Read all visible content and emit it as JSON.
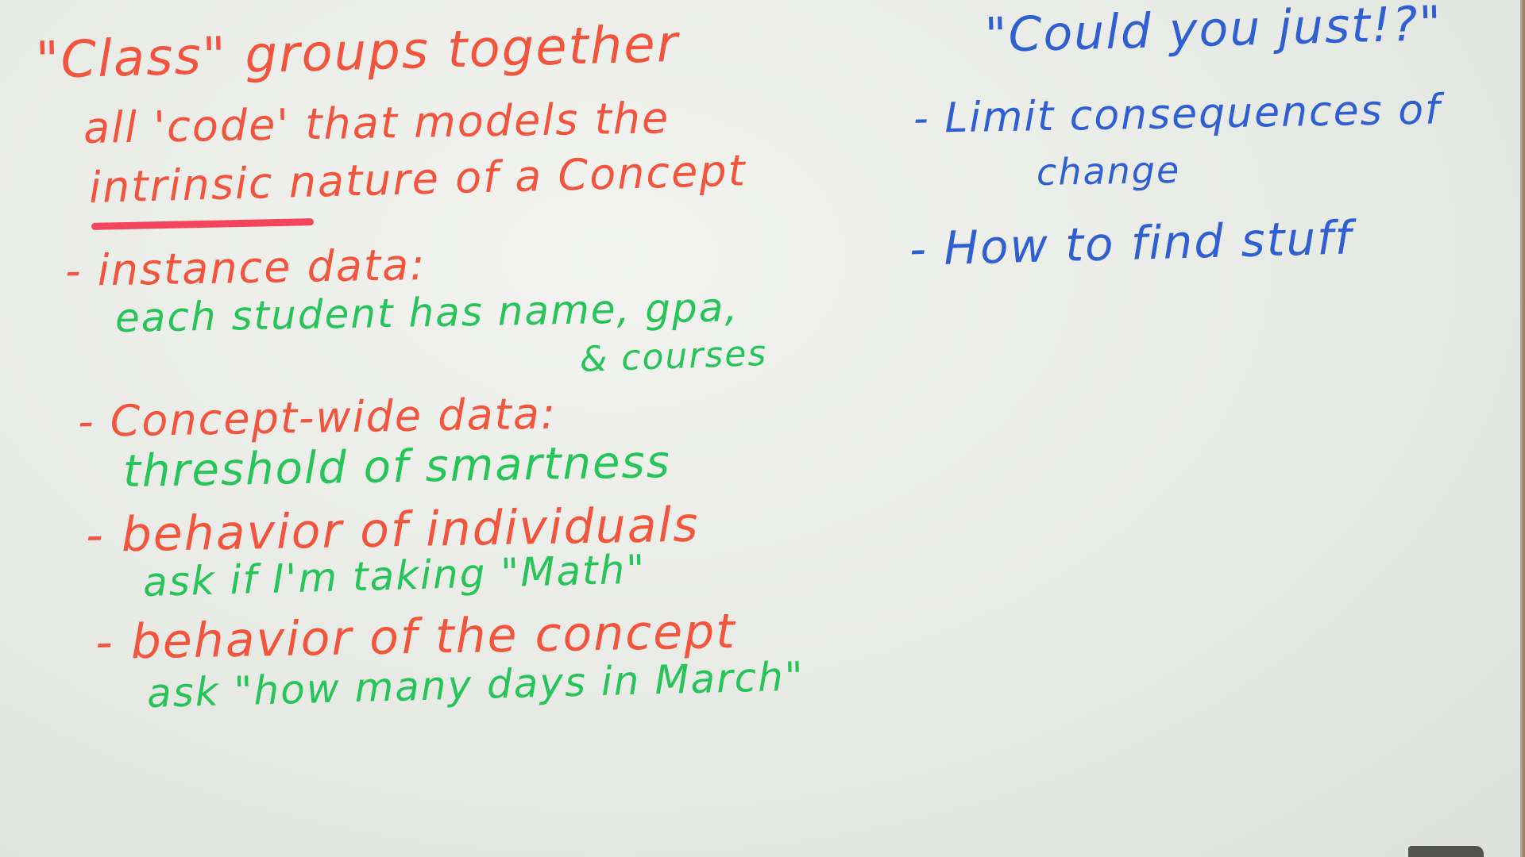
{
  "colors": {
    "red_marker": "#f2553d",
    "green_marker": "#27c45a",
    "blue_marker": "#2f5fd0",
    "board": "#e9ebe6"
  },
  "left_notes": {
    "line1": "\"Class\" groups together",
    "line2": "all 'code' that models the",
    "line3": "intrinsic nature of a Concept",
    "bullet1_title": "- instance data:",
    "bullet1_body_a": "each student has name, gpa,",
    "bullet1_body_b": "& courses",
    "bullet2_title": "- Concept-wide data:",
    "bullet2_body": "threshold of smartness",
    "bullet3_title": "- behavior of individuals",
    "bullet3_body": "ask if I'm taking \"Math\"",
    "bullet4_title": "- behavior of the concept",
    "bullet4_body": "ask \"how many days in March\""
  },
  "right_notes": {
    "title": "\"Could you just!?\"",
    "bullet1_a": "- Limit consequences of",
    "bullet1_b": "change",
    "bullet2": "- How to find stuff"
  }
}
